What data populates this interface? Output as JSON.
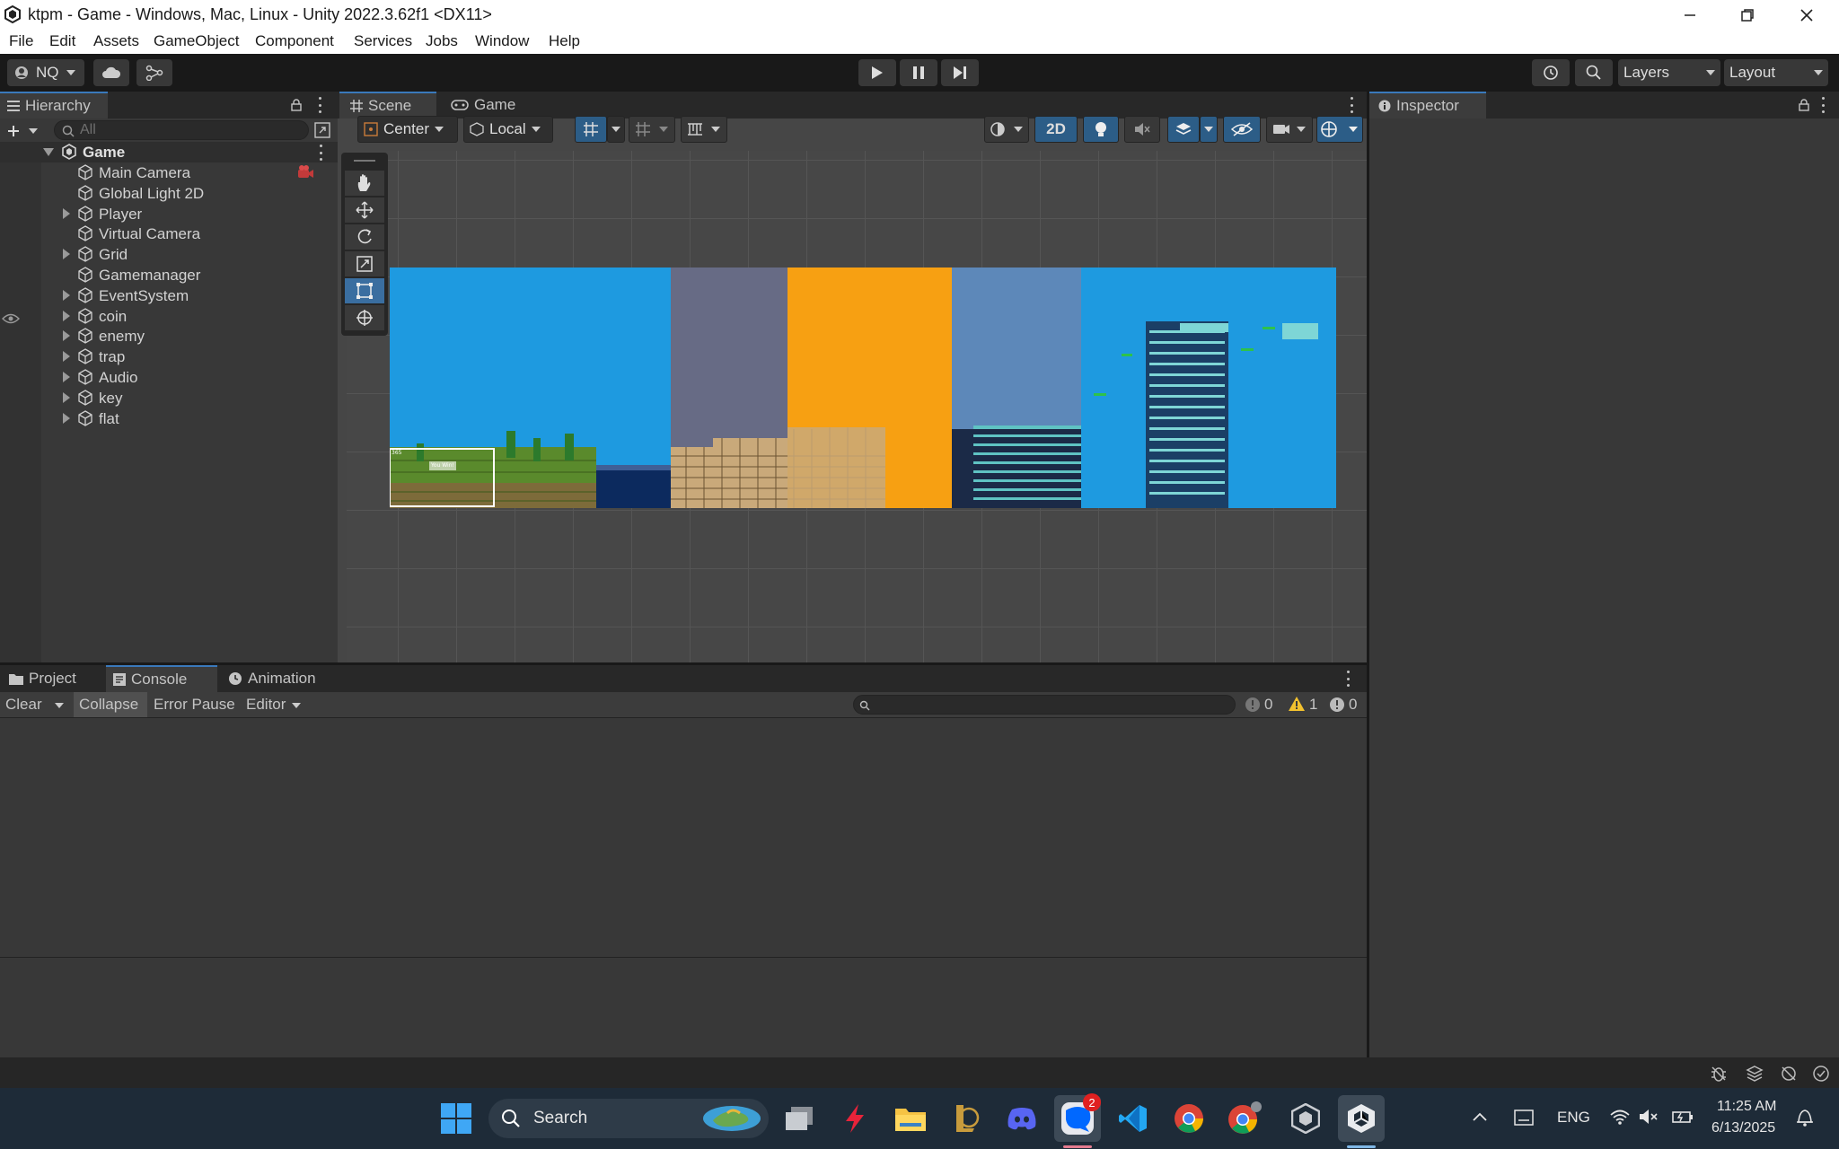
{
  "window": {
    "title": "ktpm - Game - Windows, Mac, Linux - Unity 2022.3.62f1 <DX11>"
  },
  "menu": [
    "File",
    "Edit",
    "Assets",
    "GameObject",
    "Component",
    "Services",
    "Jobs",
    "Window",
    "Help"
  ],
  "toolbar": {
    "account": "NQ",
    "layers": "Layers",
    "layout": "Layout"
  },
  "hierarchy": {
    "tab": "Hierarchy",
    "search_placeholder": "All",
    "root": "Game",
    "items": [
      {
        "label": "Main Camera",
        "expandable": false
      },
      {
        "label": "Global Light 2D",
        "expandable": false
      },
      {
        "label": "Player",
        "expandable": true
      },
      {
        "label": "Virtual Camera",
        "expandable": false
      },
      {
        "label": "Grid",
        "expandable": true
      },
      {
        "label": "Gamemanager",
        "expandable": false
      },
      {
        "label": "EventSystem",
        "expandable": true
      },
      {
        "label": "coin",
        "expandable": true
      },
      {
        "label": "enemy",
        "expandable": true
      },
      {
        "label": "trap",
        "expandable": true
      },
      {
        "label": "Audio",
        "expandable": true
      },
      {
        "label": "key",
        "expandable": true
      },
      {
        "label": "flat",
        "expandable": true
      }
    ]
  },
  "scene": {
    "tabs": [
      "Scene",
      "Game"
    ],
    "pivot": "Center",
    "space": "Local",
    "mode_2d": "2D",
    "level_preview": {
      "banner": "You Win!",
      "corner": "365"
    }
  },
  "inspector": {
    "tab": "Inspector"
  },
  "console": {
    "tabs": [
      "Project",
      "Console",
      "Animation"
    ],
    "clear": "Clear",
    "collapse": "Collapse",
    "error_pause": "Error Pause",
    "editor": "Editor",
    "counts": {
      "logs": "0",
      "warnings": "1",
      "errors": "0"
    }
  },
  "taskbar": {
    "search": "Search",
    "zalo_badge": "2",
    "language": "ENG",
    "time": "11:25 AM",
    "date": "6/13/2025"
  },
  "colors": {
    "selection_blue": "#2c5d87",
    "tab_accent": "#3a79bb",
    "sky": "#1e9ae0",
    "orange": "#f7a012"
  }
}
